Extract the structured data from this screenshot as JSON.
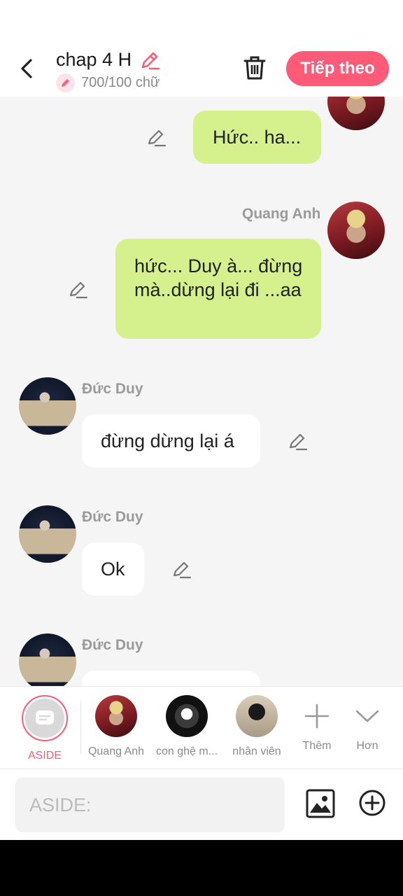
{
  "header": {
    "title": "chap 4 H",
    "count": "700/100 chữ",
    "next_label": "Tiếp theo"
  },
  "messages": [
    {
      "side": "right",
      "text": "Hức.. ha..."
    },
    {
      "side": "right",
      "name": "Quang Anh",
      "text": "hức... Duy à... đừng mà..dừng lại đi ...aa"
    },
    {
      "side": "left",
      "name": "Đức Duy",
      "text": "đừng dừng lại á"
    },
    {
      "side": "left",
      "name": "Đức Duy",
      "text": "Ok"
    },
    {
      "side": "left",
      "name": "Đức Duy",
      "text": ""
    }
  ],
  "characters": {
    "aside": "ASIDE",
    "items": [
      "Quang Anh",
      "con ghệ m...",
      "nhân viên"
    ],
    "more": "Thêm",
    "collapse": "Hơn"
  },
  "composer": {
    "placeholder": "ASIDE:"
  },
  "colors": {
    "accent": "#ff5a78",
    "my_bubble": "#d5f18e",
    "their_bubble": "#ffffff",
    "background": "#f5f5f5"
  }
}
